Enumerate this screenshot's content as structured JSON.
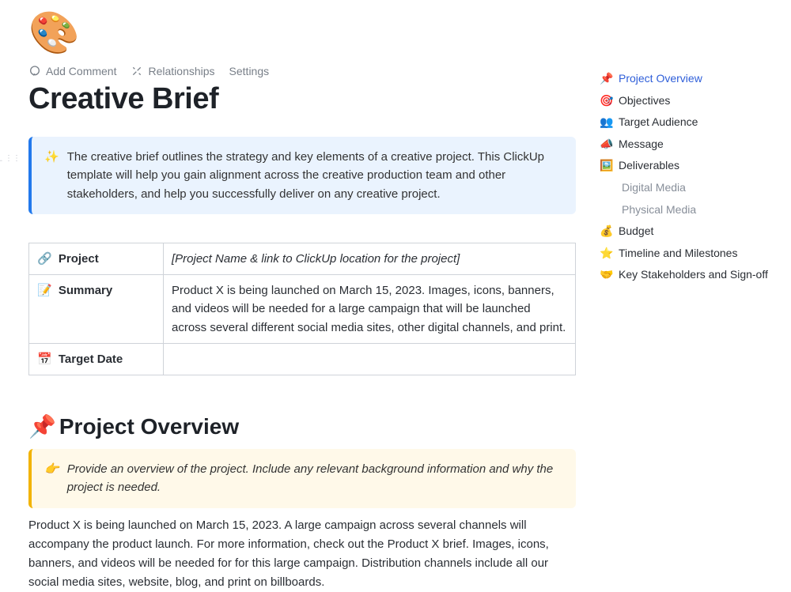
{
  "header": {
    "palette_emoji": "🎨",
    "add_comment": "Add Comment",
    "relationships": "Relationships",
    "settings": "Settings",
    "title": "Creative Brief"
  },
  "intro_callout": {
    "icon": "✨",
    "text": "The creative brief outlines the strategy and key elements of a creative project. This ClickUp template will help you gain alignment across the creative production team and other stakeholders, and help you successfully deliver on any creative project."
  },
  "info_table": {
    "rows": [
      {
        "icon": "🔗",
        "label": "Project",
        "value": "[Project Name & link to ClickUp location for the project]",
        "italic": true
      },
      {
        "icon": "📝",
        "label": "Summary",
        "value": "Product X is being launched on March 15, 2023. Images, icons, banners, and videos will be needed for a large campaign that will be launched across several different social media sites, other digital channels, and print.",
        "italic": false
      },
      {
        "icon": "📅",
        "label": "Target Date",
        "value": "",
        "italic": false
      }
    ]
  },
  "overview": {
    "heading_icon": "📌",
    "heading": "Project Overview",
    "hint_icon": "👉",
    "hint_text": "Provide an overview of the project. Include any relevant background information and why the project is needed.",
    "body": "Product X is being launched on March 15, 2023. A large campaign across several channels will accompany the product launch. For more information, check out the Product X brief. Images, icons, banners, and videos will be needed for for this large campaign. Distribution channels include all our social media sites, website, blog, and print on billboards."
  },
  "outline": [
    {
      "icon": "📌",
      "label": "Project Overview",
      "active": true
    },
    {
      "icon": "🎯",
      "label": "Objectives"
    },
    {
      "icon": "👥",
      "label": "Target Audience"
    },
    {
      "icon": "📣",
      "label": "Message"
    },
    {
      "icon": "🖼️",
      "label": "Deliverables"
    },
    {
      "label": "Digital Media",
      "sub": true
    },
    {
      "label": "Physical Media",
      "sub": true
    },
    {
      "icon": "💰",
      "label": "Budget"
    },
    {
      "icon": "⭐",
      "label": "Timeline and Milestones"
    },
    {
      "icon": "🤝",
      "label": "Key Stakeholders and Sign-off"
    }
  ]
}
